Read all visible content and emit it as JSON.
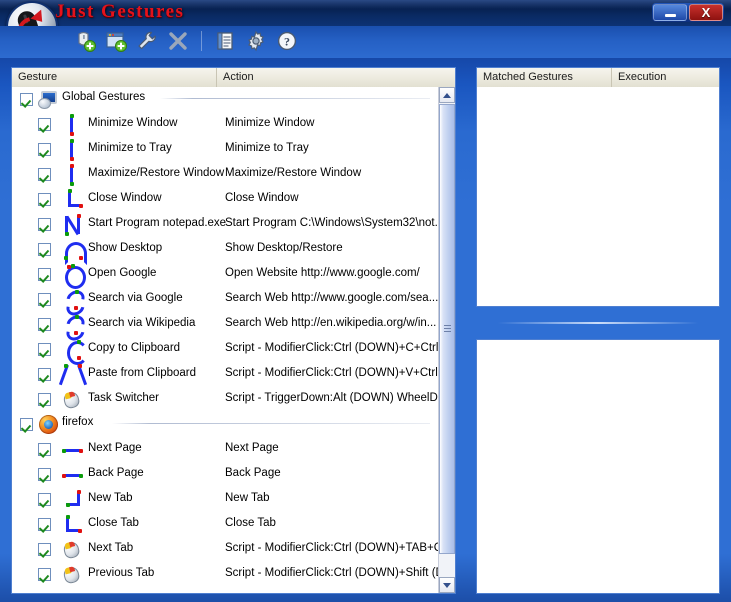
{
  "window": {
    "title": "Just Gestures",
    "logo_icon": "just-gestures-logo",
    "minimize_label": "",
    "close_label": "X"
  },
  "toolbar": {
    "buttons": [
      {
        "name": "add-gesture-icon",
        "tooltip": "Add Gesture"
      },
      {
        "name": "add-application-icon",
        "tooltip": "Add Application"
      },
      {
        "name": "properties-wrench-icon",
        "tooltip": "Properties"
      },
      {
        "name": "delete-x-icon",
        "tooltip": "Delete"
      },
      {
        "name": "log-icon",
        "tooltip": "Log"
      },
      {
        "name": "options-gear-icon",
        "tooltip": "Options"
      },
      {
        "name": "help-question-icon",
        "tooltip": "Help"
      }
    ]
  },
  "tree": {
    "columns": [
      "Gesture",
      "Action"
    ],
    "rows": [
      {
        "type": "group",
        "label": "Global Gestures",
        "checked": true,
        "icon": "monitor-icon"
      },
      {
        "type": "child",
        "label": "Minimize Window",
        "action": "Minimize Window",
        "checked": true,
        "glyph": "line-down"
      },
      {
        "type": "child",
        "label": "Minimize to Tray",
        "action": "Minimize to Tray",
        "checked": true,
        "glyph": "line-down"
      },
      {
        "type": "child",
        "label": "Maximize/Restore Window",
        "action": "Maximize/Restore Window",
        "checked": true,
        "glyph": "line-up"
      },
      {
        "type": "child",
        "label": "Close Window",
        "action": "Close Window",
        "checked": true,
        "glyph": "corner-L"
      },
      {
        "type": "child",
        "label": "Start Program notepad.exe",
        "action": "Start Program C:\\Windows\\System32\\not...",
        "checked": true,
        "glyph": "letter-N"
      },
      {
        "type": "child",
        "label": "Show Desktop",
        "action": "Show Desktop/Restore",
        "checked": true,
        "glyph": "arch"
      },
      {
        "type": "child",
        "label": "Open Google",
        "action": "Open Website http://www.google.com/",
        "checked": true,
        "glyph": "circle-O"
      },
      {
        "type": "child",
        "label": "Search via Google",
        "action": "Search Web http://www.google.com/sea...",
        "checked": true,
        "glyph": "letter-S"
      },
      {
        "type": "child",
        "label": "Search via Wikipedia",
        "action": "Search Web http://en.wikipedia.org/w/in...",
        "checked": true,
        "glyph": "letter-S"
      },
      {
        "type": "child",
        "label": "Copy to Clipboard",
        "action": "Script - ModifierClick:Ctrl (DOWN)+C+Ctrl (...",
        "checked": true,
        "glyph": "letter-C"
      },
      {
        "type": "child",
        "label": "Paste from Clipboard",
        "action": "Script - ModifierClick:Ctrl (DOWN)+V+Ctrl (...",
        "checked": true,
        "glyph": "letter-V"
      },
      {
        "type": "child",
        "label": "Task Switcher",
        "action": "Script - TriggerDown:Alt (DOWN) WheelD...",
        "checked": true,
        "glyph": "mouse"
      },
      {
        "type": "group",
        "label": "firefox",
        "checked": true,
        "icon": "firefox-icon"
      },
      {
        "type": "child",
        "label": "Next Page",
        "action": "Next Page",
        "checked": true,
        "glyph": "line-right"
      },
      {
        "type": "child",
        "label": "Back Page",
        "action": "Back Page",
        "checked": true,
        "glyph": "line-left"
      },
      {
        "type": "child",
        "label": "New Tab",
        "action": "New Tab",
        "checked": true,
        "glyph": "corner-up-right"
      },
      {
        "type": "child",
        "label": "Close Tab",
        "action": "Close Tab",
        "checked": true,
        "glyph": "corner-down-right"
      },
      {
        "type": "child",
        "label": "Next Tab",
        "action": "Script - ModifierClick:Ctrl (DOWN)+TAB+C...",
        "checked": true,
        "glyph": "mouse"
      },
      {
        "type": "child",
        "label": "Previous Tab",
        "action": "Script - ModifierClick:Ctrl (DOWN)+Shift (D...",
        "checked": true,
        "glyph": "mouse"
      }
    ],
    "scrollbar": {
      "up_arrow": "scroll-up-arrow",
      "down_arrow": "scroll-down-arrow"
    }
  },
  "matched": {
    "columns": [
      "Matched Gestures",
      "Execution"
    ],
    "rows": []
  },
  "detail": {
    "rows": []
  },
  "colors": {
    "frame_blue": "#2f6fd4",
    "title_red": "#e4121b",
    "gesture_stroke": "#1f2df0",
    "start_dot": "#0b9b0b",
    "end_dot": "#e01010",
    "check_green": "#1e8a1e",
    "header_beige": "#eceade"
  }
}
